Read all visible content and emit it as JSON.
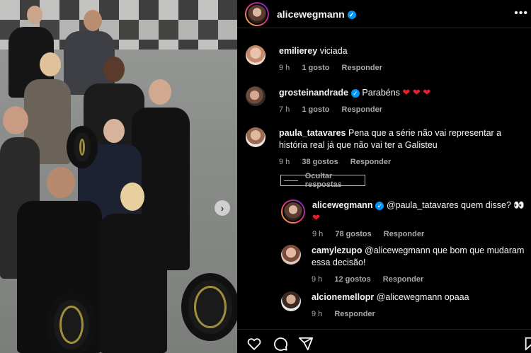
{
  "header": {
    "username": "alicewegmann",
    "more_label": "•••"
  },
  "post": {
    "next_label": "›"
  },
  "comments": [
    {
      "username": "emilierey",
      "text": "viciada",
      "time": "9 h",
      "likes": "1 gosto",
      "reply": "Responder",
      "verified": false
    },
    {
      "username": "grosteinandrade",
      "text": "Parabéns ",
      "hearts": "❤ ❤ ❤",
      "time": "7 h",
      "likes": "1 gosto",
      "reply": "Responder",
      "verified": true
    },
    {
      "username": "paula_tatavares",
      "text": "Pena que a série não vai representar a história real já que não vai ter a Galisteu",
      "time": "9 h",
      "likes": "38 gostos",
      "reply": "Responder",
      "verified": false
    }
  ],
  "hide_replies_label": "Ocultar respostas",
  "replies": [
    {
      "username": "alicewegmann",
      "text": "@paula_tatavares quem disse? 👀",
      "hearts": "❤",
      "time": "9 h",
      "likes": "78 gostos",
      "reply": "Responder",
      "verified": true
    },
    {
      "username": "camylezupo",
      "text": "@alicewegmann que bom que mudaram essa decisão!",
      "time": "9 h",
      "likes": "12 gostos",
      "reply": "Responder",
      "verified": false
    },
    {
      "username": "alcionemellopr",
      "text": "@alicewegmann opaaa",
      "time": "9 h",
      "reply": "Responder",
      "verified": false
    }
  ],
  "colors": {
    "verified": "#0095f6",
    "heart": "#ed1c2e",
    "muted": "#a8a8a8"
  },
  "icons": [
    "heart-icon",
    "comment-icon",
    "share-icon",
    "bookmark-icon"
  ]
}
